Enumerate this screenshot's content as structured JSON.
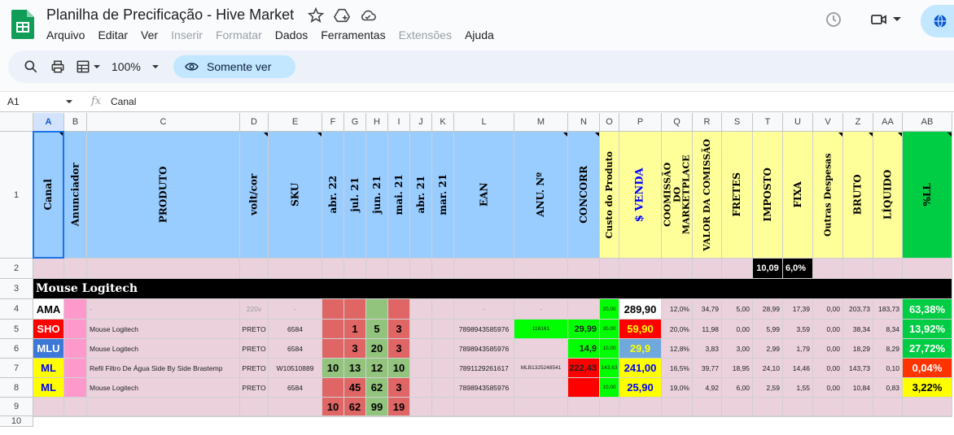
{
  "header": {
    "title": "Planilha de Precificação - Hive Market",
    "menu": [
      {
        "label": "Arquivo",
        "disabled": false
      },
      {
        "label": "Editar",
        "disabled": false
      },
      {
        "label": "Ver",
        "disabled": false
      },
      {
        "label": "Inserir",
        "disabled": true
      },
      {
        "label": "Formatar",
        "disabled": true
      },
      {
        "label": "Dados",
        "disabled": false
      },
      {
        "label": "Ferramentas",
        "disabled": false
      },
      {
        "label": "Extensões",
        "disabled": true
      },
      {
        "label": "Ajuda",
        "disabled": false
      }
    ]
  },
  "toolbar": {
    "zoom": "100%",
    "view_only_label": "Somente ver"
  },
  "formula_bar": {
    "cell_ref": "A1",
    "value": "Canal"
  },
  "sheet": {
    "columns": [
      "A",
      "B",
      "C",
      "D",
      "E",
      "F",
      "G",
      "H",
      "I",
      "J",
      "K",
      "L",
      "M",
      "N",
      "O",
      "P",
      "Q",
      "R",
      "S",
      "T",
      "U",
      "V",
      "Z",
      "AA",
      "AB"
    ],
    "header_cells": {
      "A": "Canal",
      "B": "Anunciador",
      "C": "PRODUTO",
      "D": "volt/cor",
      "E": "SKU",
      "F": "abr. 22",
      "G": "jul. 21",
      "H": "jun. 21",
      "I": "mai. 21",
      "J": "abr. 21",
      "K": "mar. 21",
      "L": "EAN",
      "M": "ANU. Nº",
      "N": "CONCORR",
      "O": "Custo do Produto",
      "P": "$ VENDA",
      "Q": "COOMISSÃO DO MARKETPLACE",
      "R": "VALOR DA COMISSÃO",
      "S": "FRETES",
      "T": "IMPOSTO",
      "U": "FIXA",
      "V": "Outras Despesas",
      "Z": "BRUTO",
      "AA": "LÍQUIDO",
      "AB": "%LL"
    },
    "row2": {
      "imposto": "10,09",
      "pct": "6,0%"
    },
    "section_title": "Mouse Logitech",
    "rows": [
      {
        "row": "4",
        "canal": "AMA",
        "produto": "-",
        "volt": "220v",
        "sku": "-",
        "f": "",
        "g": "",
        "h": "",
        "i": "",
        "ean": "-",
        "anu": "-",
        "concorr": "",
        "custo": "20,00",
        "venda": "289,90",
        "com": "12,0%",
        "vcom": "34,79",
        "frete": "5,00",
        "imp": "28,99",
        "fixa": "17,39",
        "outras": "0,00",
        "bruto": "203,73",
        "liq": "183,73",
        "ll": "63,38%"
      },
      {
        "row": "5",
        "canal": "SHO",
        "produto": "Mouse Logitech",
        "volt": "PRETO",
        "sku": "6584",
        "f": "",
        "g": "1",
        "h": "5",
        "i": "3",
        "ean": "7898943585976",
        "anu": "116161",
        "concorr": "29,99",
        "custo": "30,00",
        "venda": "59,90",
        "com": "20,0%",
        "vcom": "11,98",
        "frete": "0,00",
        "imp": "5,99",
        "fixa": "3,59",
        "outras": "0,00",
        "bruto": "38,34",
        "liq": "8,34",
        "ll": "13,92%"
      },
      {
        "row": "6",
        "canal": "MLU",
        "produto": "Mouse Logitech",
        "volt": "PRETO",
        "sku": "6584",
        "f": "",
        "g": "3",
        "h": "20",
        "i": "3",
        "ean": "7898943585976",
        "anu": "",
        "concorr": "14,9",
        "custo": "10,00",
        "venda": "29,9",
        "com": "12,8%",
        "vcom": "3,83",
        "frete": "3,00",
        "imp": "2,99",
        "fixa": "1,79",
        "outras": "0,00",
        "bruto": "18,29",
        "liq": "8,29",
        "ll": "27,72%"
      },
      {
        "row": "7",
        "canal": "ML",
        "produto": "Refil Filtro De Água Side By Side Brastemp",
        "volt": "PRETO",
        "sku": "W10510889",
        "f": "10",
        "g": "13",
        "h": "12",
        "i": "10",
        "ean": "7891129261617",
        "anu": "MLB1325248541",
        "concorr": "222,43",
        "custo": "143,63",
        "venda": "241,00",
        "com": "16,5%",
        "vcom": "39,77",
        "frete": "18,95",
        "imp": "24,10",
        "fixa": "14,46",
        "outras": "0,00",
        "bruto": "143,73",
        "liq": "0,10",
        "ll": "0,04%"
      },
      {
        "row": "8",
        "canal": "ML",
        "produto": "Mouse Logitech",
        "volt": "PRETO",
        "sku": "6584",
        "f": "",
        "g": "45",
        "h": "62",
        "i": "3",
        "ean": "7898943585976",
        "anu": "",
        "concorr": "",
        "custo": "10,00",
        "venda": "25,90",
        "com": "19,0%",
        "vcom": "4,92",
        "frete": "6,00",
        "imp": "2,59",
        "fixa": "1,55",
        "outras": "0,00",
        "bruto": "10,84",
        "liq": "0,83",
        "ll": "3,22%"
      }
    ],
    "totals": {
      "f": "10",
      "g": "62",
      "h": "99",
      "i": "19"
    },
    "row_numbers": [
      "1",
      "2",
      "3",
      "4",
      "5",
      "6",
      "7",
      "8",
      "9",
      "10"
    ],
    "colors": {
      "header_blue": "#99ccff",
      "header_yellow": "#ffff99",
      "header_green": "#00cc44",
      "row_pink": "#ead1dc",
      "red_cell": "#e06666",
      "green_cell": "#93c47d",
      "canal_sho": "#ff0000",
      "canal_mlu": "#3c78d8",
      "canal_ml": "#ffff00"
    }
  }
}
